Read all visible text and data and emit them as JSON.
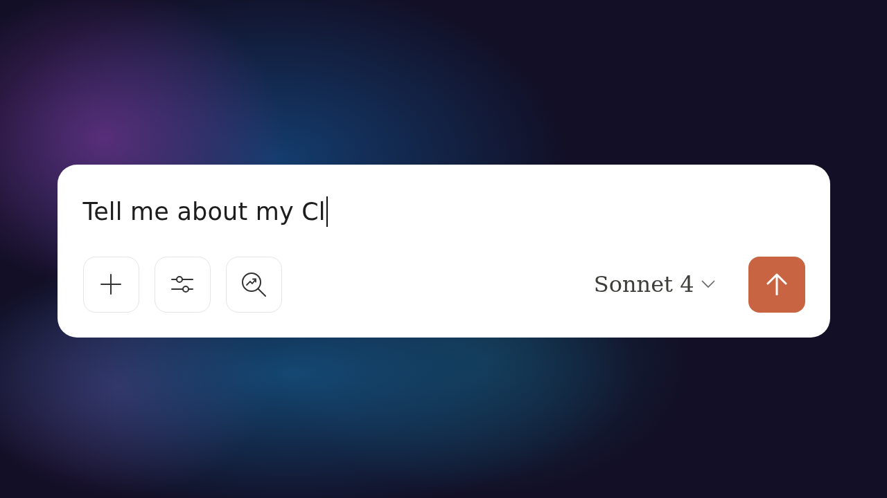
{
  "composer": {
    "value": "Tell me about my Cl",
    "tools": [
      {
        "kind": "add"
      },
      {
        "kind": "settings"
      },
      {
        "kind": "research"
      }
    ],
    "model": "Sonnet 4"
  }
}
